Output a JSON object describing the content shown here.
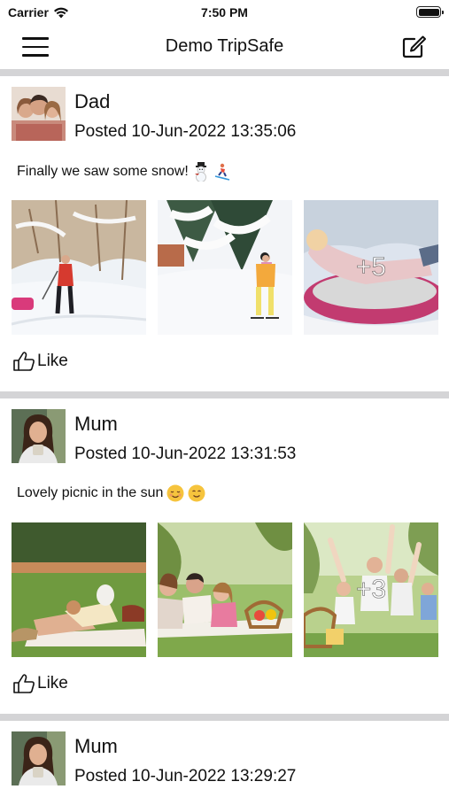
{
  "status_bar": {
    "carrier": "Carrier",
    "time": "7:50 PM"
  },
  "nav": {
    "title": "Demo TripSafe",
    "menu_icon": "hamburger-menu-icon",
    "compose_icon": "compose-icon"
  },
  "posts": [
    {
      "author": "Dad",
      "timestamp": "Posted 10-Jun-2022 13:35:06",
      "caption": "Finally we saw some snow!",
      "caption_emojis": [
        "snowman",
        "skier"
      ],
      "more_count": "+5",
      "like_label": "Like"
    },
    {
      "author": "Mum",
      "timestamp": "Posted 10-Jun-2022 13:31:53",
      "caption": "Lovely picnic in the sun",
      "caption_emojis": [
        "smiling-face",
        "smiling-face"
      ],
      "more_count": "+3",
      "like_label": "Like"
    },
    {
      "author": "Mum",
      "timestamp": "Posted 10-Jun-2022 13:29:27"
    }
  ],
  "colors": {
    "separator": "#d4d4d6",
    "background": "#ffffff",
    "text": "#111111"
  }
}
